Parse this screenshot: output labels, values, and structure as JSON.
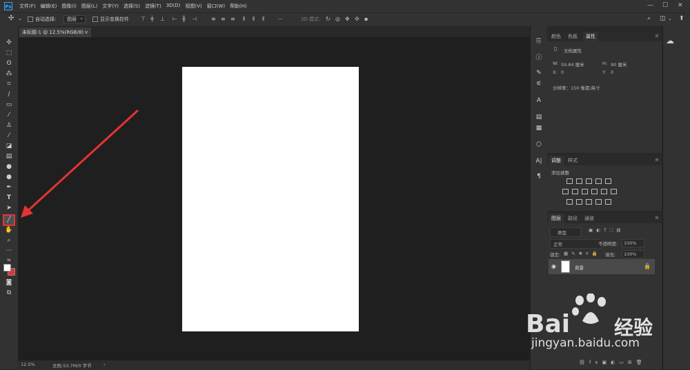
{
  "app": {
    "logo": "Ps"
  },
  "menubar": {
    "items": [
      "文件(F)",
      "编辑(E)",
      "图像(I)",
      "图层(L)",
      "文字(Y)",
      "选择(S)",
      "滤镜(T)",
      "3D(D)",
      "视图(V)",
      "窗口(W)",
      "帮助(H)"
    ],
    "window_controls": [
      "—",
      "☐",
      "✕"
    ]
  },
  "options_bar": {
    "auto_select_label": "自动选择:",
    "auto_select_value": "图层",
    "show_transform_label": "显示变换控件",
    "mode_3d_label": "3D 模式:"
  },
  "document_tab": {
    "title": "未标题-1 @ 12.5%(RGB/8)",
    "close": "×"
  },
  "status_bar": {
    "zoom": "12.5%",
    "doc_info": "文档:53.7M/0 字节",
    "arrow": "›"
  },
  "tools": [
    "move-tool",
    "marquee-tool",
    "lasso-tool",
    "magic-wand-tool",
    "crop-tool",
    "eyedropper-tool",
    "healing-tool",
    "brush-tool",
    "clone-stamp-tool",
    "history-brush-tool",
    "eraser-tool",
    "gradient-tool",
    "blur-tool",
    "dodge-tool",
    "pen-tool",
    "type-tool",
    "path-selection-tool",
    "line-tool",
    "hand-tool",
    "zoom-tool",
    "more-tools",
    "color-swatches",
    "quick-mask",
    "screen-mode"
  ],
  "properties_panel": {
    "tabs": [
      "颜色",
      "色板",
      "属性"
    ],
    "active_tab": "属性",
    "section_title": "文档属性",
    "w_label": "W:",
    "w_value": "59.84 厘米",
    "h_label": "H:",
    "h_value": "90 厘米",
    "x_label": "X:",
    "x_value": "0",
    "y_label": "Y:",
    "y_value": "0",
    "resolution": "分辨率：150 像素/英寸"
  },
  "adjustments_panel": {
    "tabs": [
      "调整",
      "样式"
    ],
    "active_tab": "调整",
    "add_label": "添加调整"
  },
  "layers_panel": {
    "tabs": [
      "图层",
      "路径",
      "通道"
    ],
    "active_tab": "图层",
    "filter_label": "类型",
    "blend_mode": "正常",
    "opacity_label": "不透明度:",
    "opacity_value": "100%",
    "lock_label": "锁定:",
    "fill_label": "填充:",
    "fill_value": "100%",
    "layers": [
      {
        "name": "背景"
      }
    ]
  },
  "watermark": {
    "brand": "Bai",
    "brand_cn": "经验",
    "url": "jingyan.baidu.com"
  },
  "colors": {
    "accent": "#31a8ff",
    "highlight": "#e53333",
    "canvas": "#1f1f1f",
    "document": "#ffffff"
  }
}
